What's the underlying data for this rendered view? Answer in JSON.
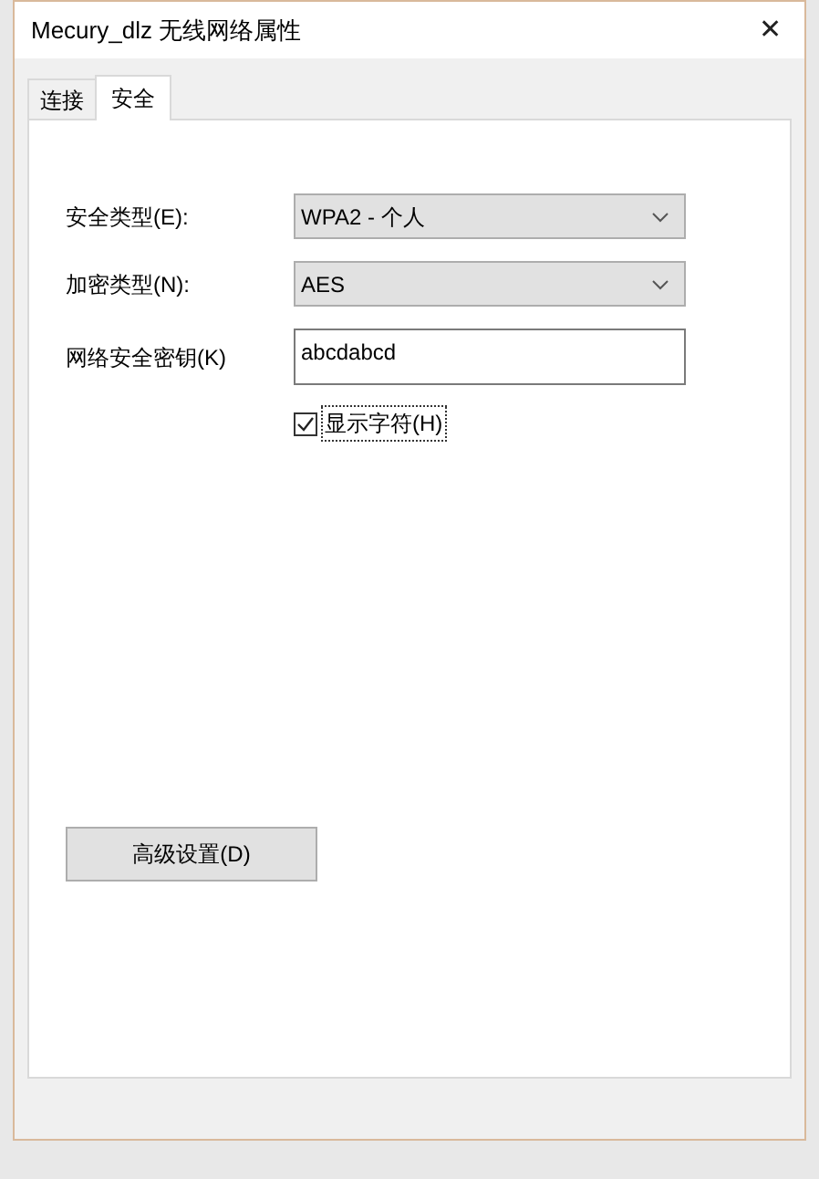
{
  "window": {
    "title": "Mecury_dlz 无线网络属性",
    "close": "✕"
  },
  "tabs": [
    {
      "label": "连接",
      "selected": false
    },
    {
      "label": "安全",
      "selected": true
    }
  ],
  "fields": [
    {
      "kind": "select",
      "label": "安全类型(E):",
      "value": "WPA2 - 个人"
    },
    {
      "kind": "select",
      "label": "加密类型(N):",
      "value": "AES"
    },
    {
      "kind": "text",
      "label": "网络安全密钥(K)",
      "value": "abcdabcd"
    }
  ],
  "show_characters": {
    "label": "显示字符(H)",
    "checked": true
  },
  "advanced_button": "高级设置(D)"
}
